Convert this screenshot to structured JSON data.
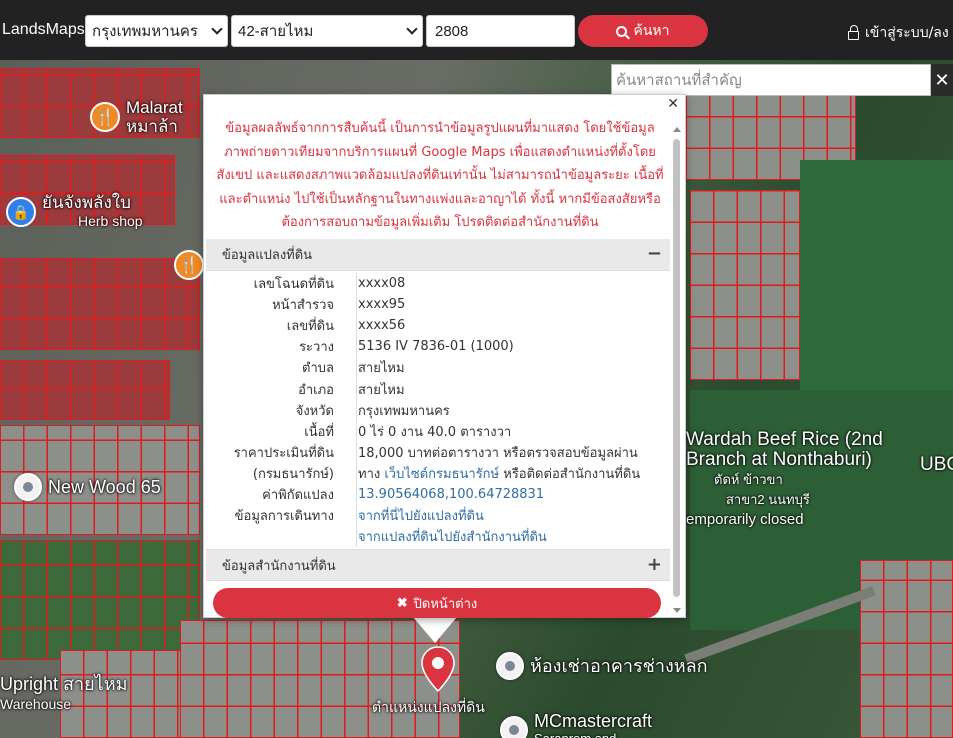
{
  "navbar": {
    "brand": "LandsMaps",
    "province": "กรุงเทพมหานคร",
    "district": "42-สายไหม",
    "parcel_no": "2808",
    "search_label": "ค้นหา",
    "login_label": "เข้าสู่ระบบ/ลง"
  },
  "place_search": {
    "placeholder": "ค้นหาสถานที่สำคัญ",
    "close": "✕"
  },
  "popup": {
    "close": "✕",
    "disclaimer": [
      "ข้อมูลผลลัพธ์จากการสืบค้นนี้ เป็นการนำข้อมูลรูปแผนที่มาแสดง โดยใช้ข้อมูล",
      "ภาพถ่ายดาวเทียมจากบริการแผนที่ Google Maps เพื่อแสดงตำแหน่งที่ตั้งโดย",
      "สังเขป และแสดงสภาพแวดล้อมแปลงที่ดินเท่านั้น ไม่สามารถนำข้อมูลระยะ เนื้อที่",
      "และตำแหน่ง ไปใช้เป็นหลักฐานในทางแพ่งและอาญาได้ ทั้งนี้ หากมีข้อสงสัยหรือ",
      "ต้องการสอบถามข้อมูลเพิ่มเติม โปรดติดต่อสำนักงานที่ดิน"
    ],
    "section_parcel": {
      "title": "ข้อมูลแปลงที่ดิน",
      "toggle": "−"
    },
    "section_office": {
      "title": "ข้อมูลสำนักงานที่ดิน",
      "toggle": "+"
    },
    "rows": [
      {
        "k": "เลขโฉนดที่ดิน",
        "v": "xxxx08"
      },
      {
        "k": "หน้าสำรวจ",
        "v": "xxxx95"
      },
      {
        "k": "เลขที่ดิน",
        "v": "xxxx56"
      },
      {
        "k": "ระวาง",
        "v": "5136 IV 7836-01 (1000)"
      },
      {
        "k": "ตำบล",
        "v": "สายไหม"
      },
      {
        "k": "อำเภอ",
        "v": "สายไหม"
      },
      {
        "k": "จังหวัด",
        "v": "กรุงเทพมหานคร"
      },
      {
        "k": "เนื้อที่",
        "v": "0 ไร่ 0 งาน 40.0 ตารางวา"
      },
      {
        "k": "ราคาประเมินที่ดิน",
        "v": "18,000 บาทต่อตารางวา หรือตรวจสอบข้อมูลผ่าน"
      }
    ],
    "dept_row": {
      "k": "(กรมธนารักษ์)",
      "v_pre": "ทาง ",
      "v_link": "เว็บไซต์กรมธนารักษ์",
      "v_post": " หรือติดต่อสำนักงานที่ดิน"
    },
    "coord_row": {
      "k": "ค่าพิกัดแปลง",
      "v": "13.90564068,100.64728831"
    },
    "nav_row": {
      "k": "ข้อมูลการเดินทาง",
      "v1": "จากที่นี่ไปยังแปลงที่ดิน",
      "v2": "จากแปลงที่ดินไปยังสำนักงานที่ดิน"
    },
    "close_button": "ปิดหน้าต่าง"
  },
  "map": {
    "pois": {
      "malarat": [
        "Malarat",
        "หมาล้า"
      ],
      "herb_name": "ยันจังพลังใบ",
      "herb_sub": "Herb shop",
      "new_wood": "New Wood 65",
      "wardah_1": "Wardah Beef Rice (2nd",
      "wardah_2": "Branch at Nonthaburi)",
      "wardah_3": "ตัดห์ ข้าวขา",
      "wardah_4": "สาขา2 นนทบุรี",
      "wardah_5": "emporarily closed",
      "ubc": "UBC",
      "upright_1": "Upright สายไหม",
      "upright_2": "Warehouse",
      "room": "ห้องเช่าอาคารช่างหลก",
      "mc": "MCmastercraft",
      "mc_sub": "Saranrom and",
      "marker_label": "ตำแหน่งแปลงที่ดิน"
    }
  },
  "colors": {
    "accent": "#d9343f",
    "navbar": "#222222",
    "link": "#2e6da4",
    "parcel_line": "#e01b1b"
  }
}
